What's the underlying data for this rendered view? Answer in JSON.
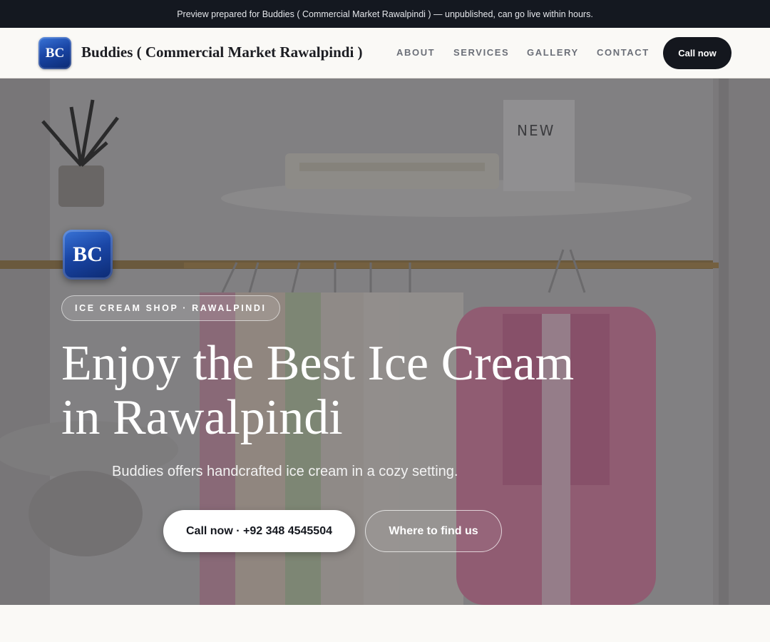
{
  "banner": {
    "text": "Preview prepared for Buddies ( Commercial Market Rawalpindi ) — unpublished, can go live within hours."
  },
  "nav": {
    "logo_initials": "BC",
    "brand_name": "Buddies ( Commercial Market Rawalpindi )",
    "links": [
      "ABOUT",
      "SERVICES",
      "GALLERY",
      "CONTACT"
    ],
    "call_label": "Call now"
  },
  "hero": {
    "logo_initials": "BC",
    "tag": "ICE CREAM SHOP · RAWALPINDI",
    "title_line1": "Enjoy the Best Ice Cream",
    "title_line2": "in Rawalpindi",
    "subtitle": "Buddies offers handcrafted ice cream in a cozy setting.",
    "call_button": "Call now · +92 348 4545504",
    "find_button": "Where to find us",
    "photo_sign_text": "NEW"
  },
  "colors": {
    "banner_bg": "#141820",
    "accent_dark": "#14171e",
    "logo_blue": "#1a46a6",
    "page_bg": "#faf9f6"
  }
}
